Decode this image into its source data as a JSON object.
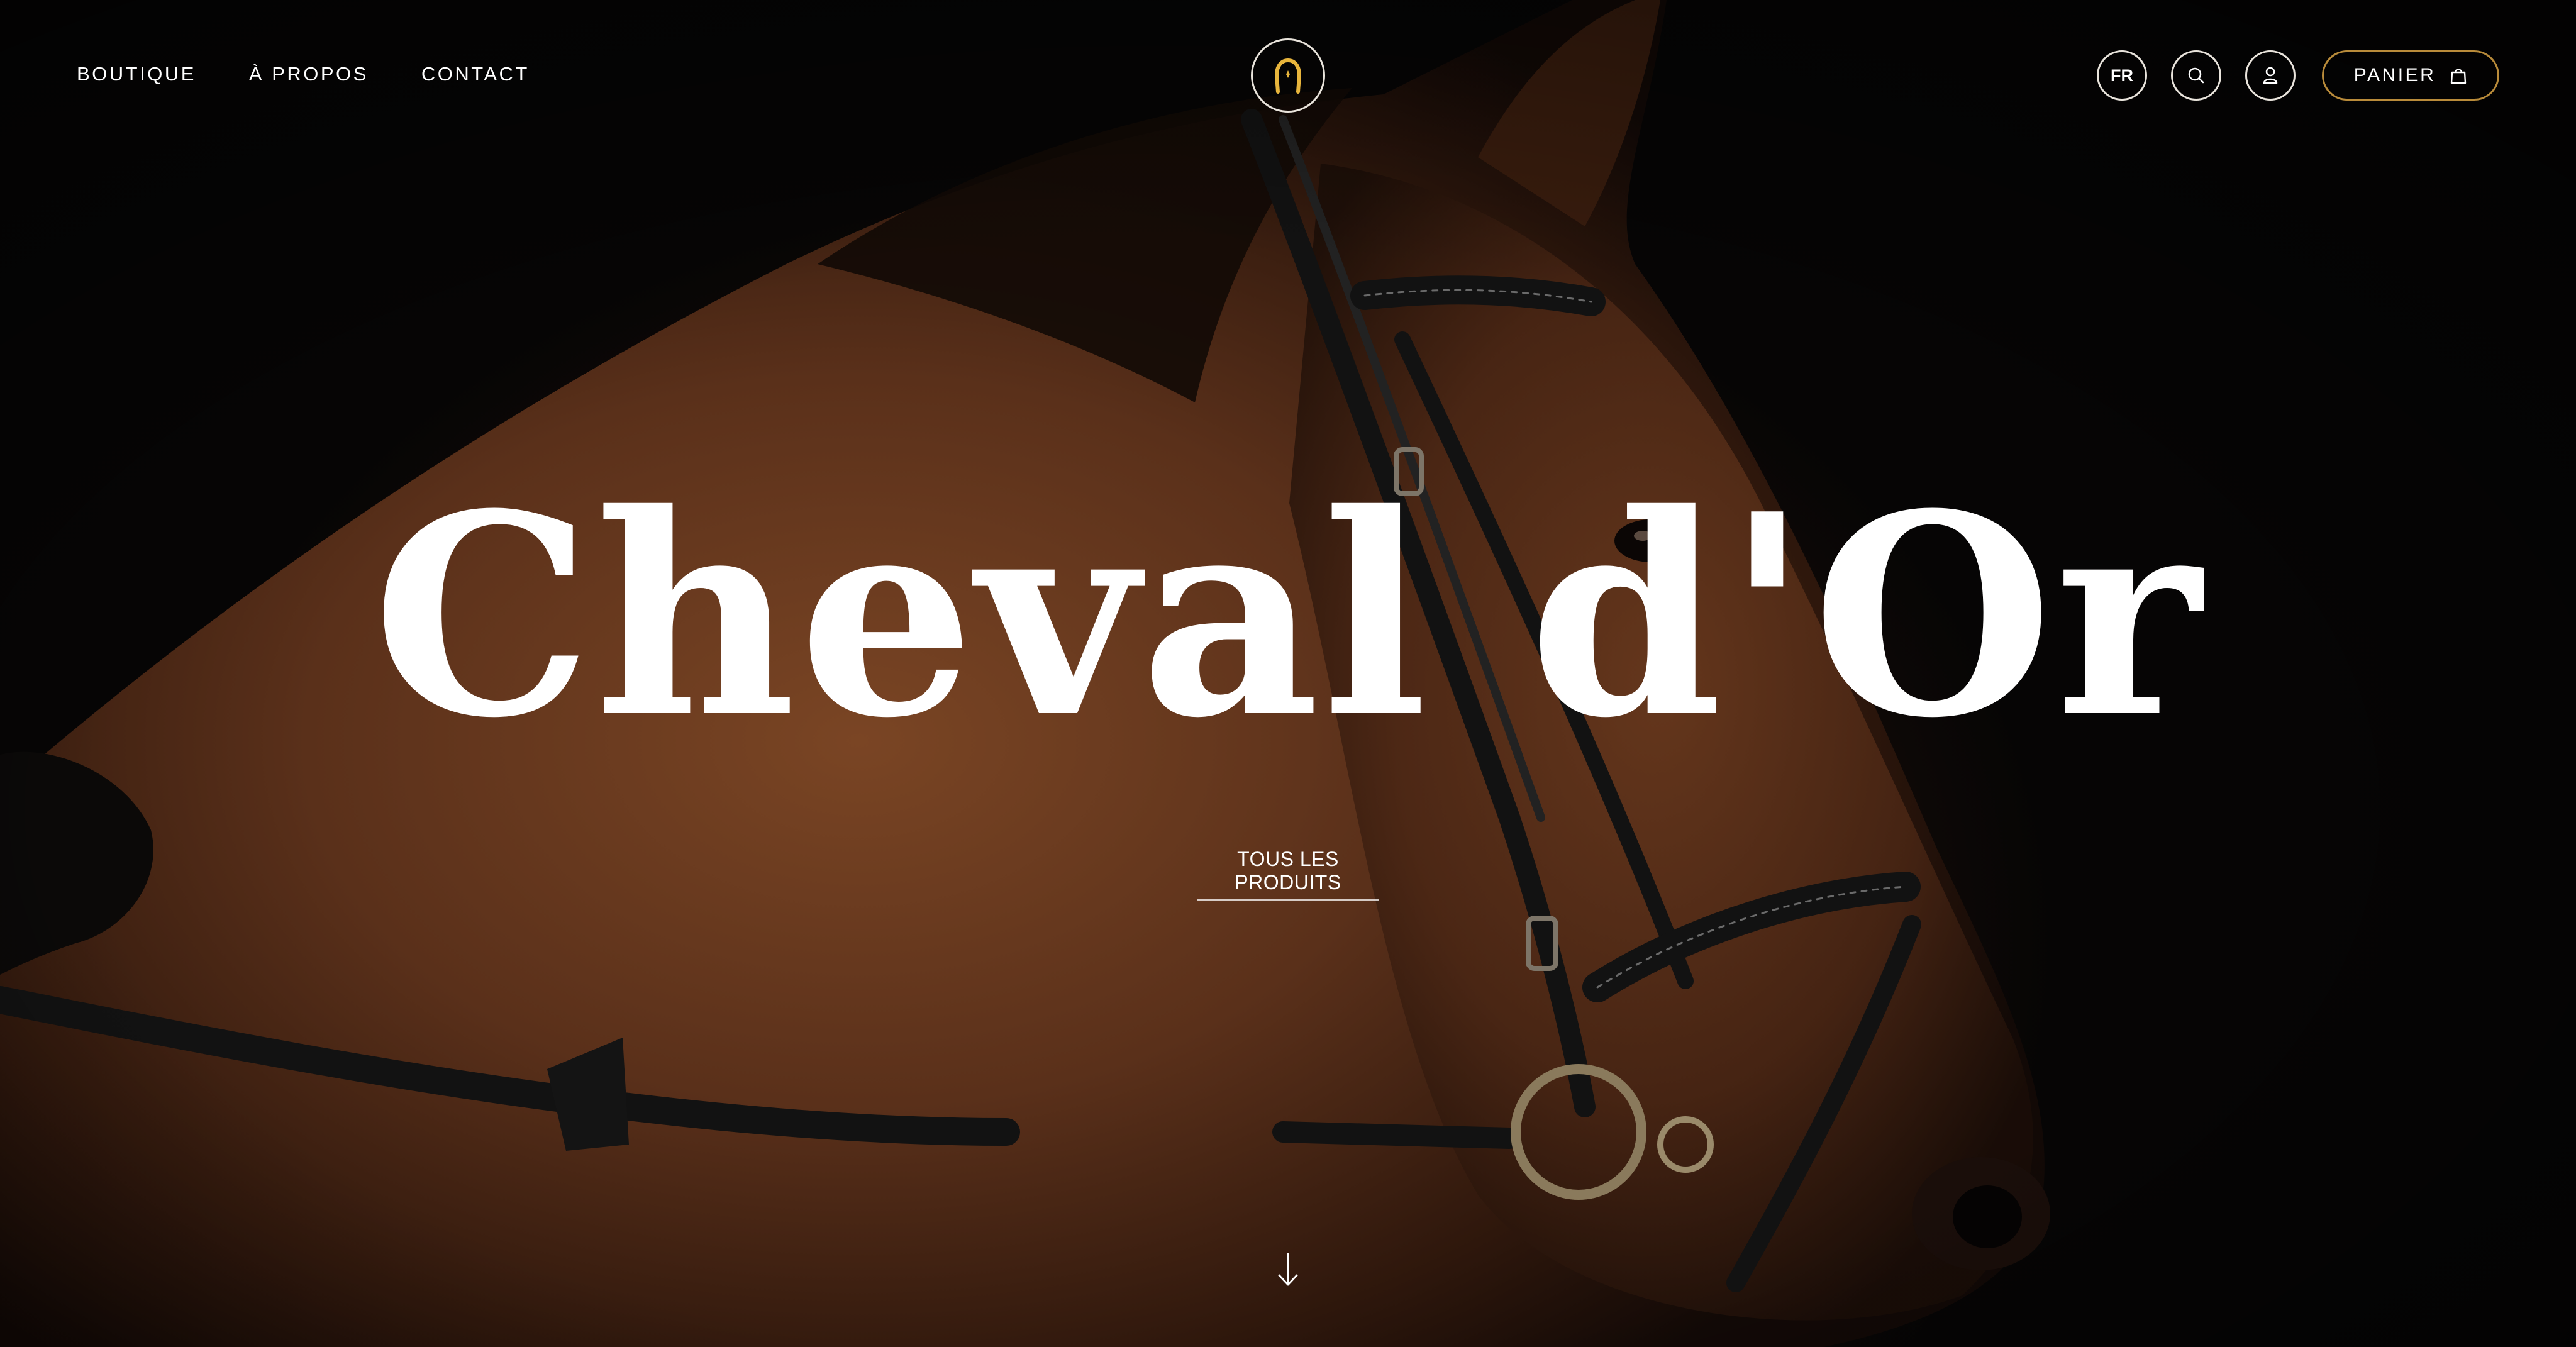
{
  "nav": {
    "links": [
      {
        "label": "BOUTIQUE"
      },
      {
        "label": "À PROPOS"
      },
      {
        "label": "CONTACT"
      }
    ],
    "logo_icon": "horseshoe-icon",
    "language": "FR",
    "search_icon": "search-icon",
    "account_icon": "user-icon",
    "cart": {
      "label": "PANIER",
      "icon": "shopping-bag-icon"
    }
  },
  "hero": {
    "title": "Cheval d'Or",
    "cta_label": "TOUS LES PRODUITS",
    "scroll_icon": "arrow-down-icon",
    "image_subject": "horse-with-bridle"
  },
  "colors": {
    "background": "#060505",
    "accent_gold": "#e8b53c",
    "cart_border": "#b98b3a",
    "text": "#ffffff"
  }
}
